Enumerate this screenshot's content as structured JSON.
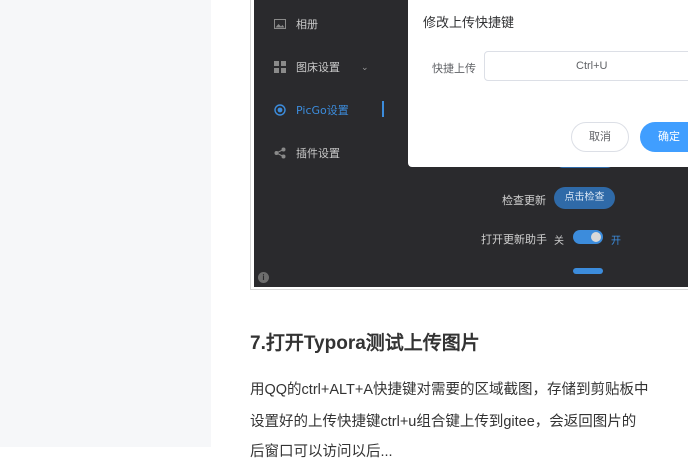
{
  "sidebar": {
    "items": [
      {
        "label": "相册",
        "icon": "image-icon"
      },
      {
        "label": "图床设置",
        "icon": "grid-icon"
      },
      {
        "label": "PicGo设置",
        "icon": "radio-dot-icon"
      },
      {
        "label": "插件设置",
        "icon": "share-icon"
      }
    ]
  },
  "settings": {
    "check_update_label": "检查更新",
    "check_update_button": "点击检查",
    "update_helper_label": "打开更新助手",
    "toggle_off": "关",
    "toggle_on": "开",
    "toggle_state": "on"
  },
  "modal": {
    "title": "修改上传快捷键",
    "field_label": "快捷上传",
    "field_value": "Ctrl+U",
    "cancel": "取消",
    "confirm": "确定"
  },
  "article": {
    "heading": "7.打开Typora测试上传图片",
    "lines": [
      "用QQ的ctrl+ALT+A快捷键对需要的区域截图，存储到剪贴板中",
      "设置好的上传快捷键ctrl+u组合键上传到gitee，会返回图片的",
      "后窗口可以访问以后..."
    ]
  },
  "colors": {
    "accent": "#409eff",
    "app_bg": "#2a2a2d",
    "active_nav": "#3c8cdc"
  }
}
